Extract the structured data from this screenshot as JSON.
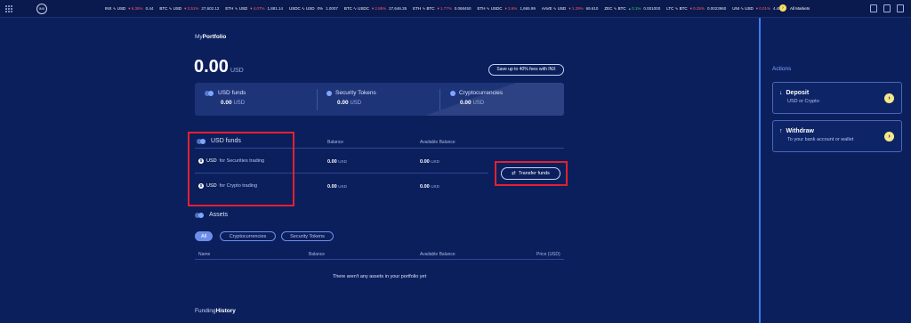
{
  "ticker": [
    {
      "pair": "INX ∿ USD",
      "change": "▾ 6.35%",
      "dir": "down",
      "price": "0.44"
    },
    {
      "pair": "BTC ∿ USD",
      "change": "▾ 2.51%",
      "dir": "down",
      "price": "27,602.12"
    },
    {
      "pair": "ETH ∿ USD",
      "change": "▾ 4.07%",
      "dir": "down",
      "price": "1,881.14"
    },
    {
      "pair": "USDC ∿ USD",
      "change": "0%",
      "dir": "flat",
      "price": "1.0007"
    },
    {
      "pair": "BTC ∿ USDC",
      "change": "▾ 2.95%",
      "dir": "down",
      "price": "27,646.35"
    },
    {
      "pair": "ETH ∿ BTC",
      "change": "▾ 1.77%",
      "dir": "down",
      "price": "0.068450"
    },
    {
      "pair": "ETH ∿ USDC",
      "change": "▾ 3.6%",
      "dir": "down",
      "price": "1,665.99"
    },
    {
      "pair": "AAVE ∿ USD",
      "change": "▾ 1.29%",
      "dir": "down",
      "price": "69.610"
    },
    {
      "pair": "ZEC ∿ BTC",
      "change": "▴ 0.1%",
      "dir": "up",
      "price": "0.001000"
    },
    {
      "pair": "LTC ∿ BTC",
      "change": "▾ 0.25%",
      "dir": "down",
      "price": "0.0023960"
    },
    {
      "pair": "UNI ∿ USD",
      "change": "▾ 0.01%",
      "dir": "down",
      "price": "4.4897"
    }
  ],
  "header": {
    "logo": "INX",
    "all_markets": "All Markets"
  },
  "portfolio": {
    "title_prefix": "My",
    "title_bold": "Portfolio",
    "balance": "0.00",
    "balance_unit": "USD",
    "save_button": "Save up to 40% fees with INX",
    "summary": [
      {
        "label": "USD funds",
        "value": "0.00",
        "unit": "USD"
      },
      {
        "label": "Security Tokens",
        "value": "0.00",
        "unit": "USD"
      },
      {
        "label": "Cryptocurrencies",
        "value": "0.00",
        "unit": "USD"
      }
    ]
  },
  "usd_funds": {
    "heading": "USD funds",
    "col_balance": "Balance",
    "col_available": "Available Balance",
    "rows": [
      {
        "label": "USD",
        "suffix": "for Securities trading",
        "balance": "0.00",
        "available": "0.00",
        "unit": "USD"
      },
      {
        "label": "USD",
        "suffix": "for Crypto trading",
        "balance": "0.00",
        "available": "0.00",
        "unit": "USD"
      }
    ],
    "transfer_button": "Transfer funds"
  },
  "assets": {
    "heading": "Assets",
    "filters": [
      "All",
      "Cryptocurrencies",
      "Security Tokens"
    ],
    "columns": [
      "Name",
      "Balance",
      "Available Balance",
      "Price (USD)"
    ],
    "empty_message": "There aren't any assets in your portfolio yet"
  },
  "funding": {
    "title_prefix": "Funding",
    "title_bold": "History"
  },
  "actions": {
    "title": "Actions",
    "deposit": {
      "label": "Deposit",
      "sub": "USD or Crypto"
    },
    "withdraw": {
      "label": "Withdraw",
      "sub": "To your bank account or wallet"
    }
  },
  "colors": {
    "background": "#0b1f5c",
    "highlight": "#e5202e",
    "accent": "#3e7cf0",
    "cta": "#f6e98a"
  }
}
